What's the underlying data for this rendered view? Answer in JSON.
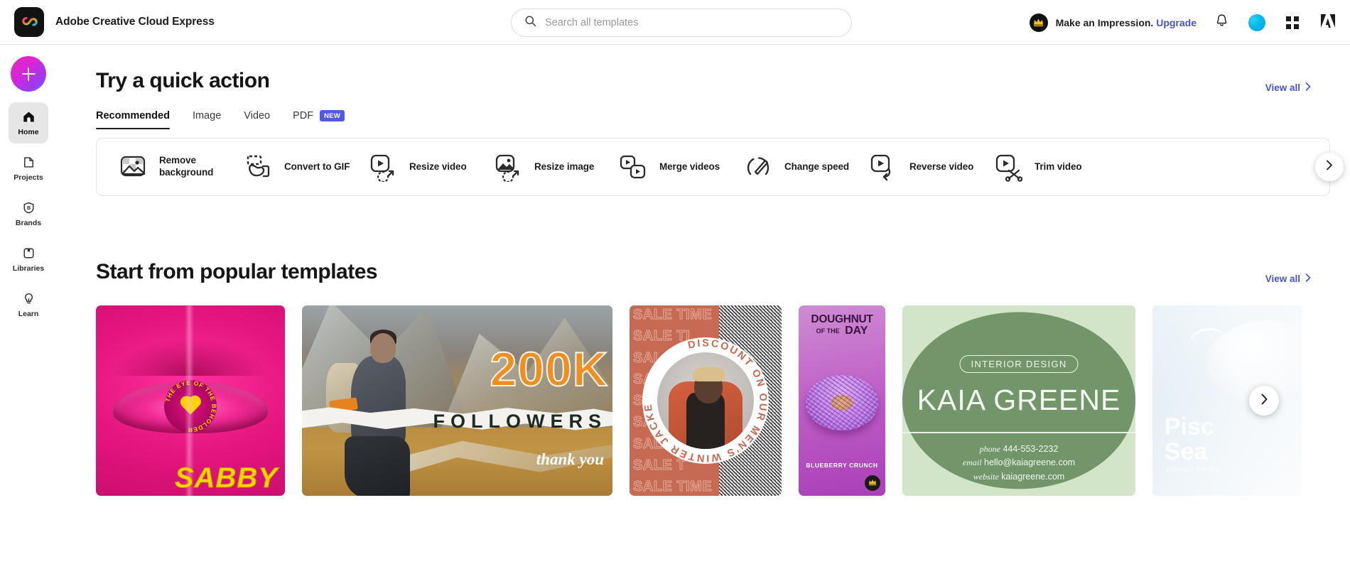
{
  "app": {
    "brand_name": "Adobe Creative Cloud Express",
    "logo_icon": "creative-cloud-express-logo"
  },
  "search": {
    "placeholder": "Search all templates",
    "value": "",
    "icon": "search-icon"
  },
  "header": {
    "upsell_text": "Make an Impression.",
    "upsell_link": "Upgrade",
    "crown_icon": "crown-icon",
    "notifications_icon": "bell-icon",
    "avatar_icon": "user-avatar",
    "apps_icon": "app-grid-icon",
    "adobe_icon": "adobe-logo-icon"
  },
  "sidebar": {
    "create_button_label": "+",
    "create_button_icon": "plus-icon",
    "items": [
      {
        "label": "Home",
        "icon": "home-icon",
        "active": true
      },
      {
        "label": "Projects",
        "icon": "document-icon",
        "active": false
      },
      {
        "label": "Brands",
        "icon": "brand-shield-icon",
        "active": false
      },
      {
        "label": "Libraries",
        "icon": "library-box-icon",
        "active": false
      },
      {
        "label": "Learn",
        "icon": "lightbulb-icon",
        "active": false
      }
    ]
  },
  "quick_action": {
    "title": "Try a quick action",
    "view_all": "View all",
    "view_all_icon": "chevron-right-icon",
    "tabs": [
      {
        "label": "Recommended",
        "active": true,
        "badge": ""
      },
      {
        "label": "Image",
        "active": false,
        "badge": ""
      },
      {
        "label": "Video",
        "active": false,
        "badge": ""
      },
      {
        "label": "PDF",
        "active": false,
        "badge": "NEW"
      }
    ],
    "actions": [
      {
        "label": "Remove background",
        "icon": "remove-background-icon"
      },
      {
        "label": "Convert to GIF",
        "icon": "convert-to-gif-icon"
      },
      {
        "label": "Resize video",
        "icon": "resize-video-icon"
      },
      {
        "label": "Resize image",
        "icon": "resize-image-icon"
      },
      {
        "label": "Merge videos",
        "icon": "merge-videos-icon"
      },
      {
        "label": "Change speed",
        "icon": "change-speed-icon"
      },
      {
        "label": "Reverse video",
        "icon": "reverse-video-icon"
      },
      {
        "label": "Trim video",
        "icon": "trim-video-icon"
      }
    ],
    "next_icon": "chevron-right-icon"
  },
  "templates": {
    "title": "Start from popular templates",
    "view_all": "View all",
    "view_all_icon": "chevron-right-icon",
    "next_icon": "chevron-right-icon",
    "cards": [
      {
        "name": "eye-of-the-beholder-sabby",
        "ring_text": "THE EYE OF THE BEHOLDER",
        "artist": "SABBY",
        "premium": false
      },
      {
        "name": "200k-followers-thank-you",
        "count": "200K",
        "subtitle": "FOLLOWERS",
        "thanks": "thank you",
        "premium": false
      },
      {
        "name": "sale-time-winter-jackets",
        "repeat_text": "SALE TIME",
        "ring_text": "DISCOUNT ON OUR MEN'S WINTER JACKETS",
        "repeat_lines": [
          "SALE TIME",
          "SALE TI",
          "SAL",
          "SA",
          "SA",
          "SAL",
          "SALE",
          "SALE T",
          "SALE TIME"
        ],
        "premium": false
      },
      {
        "name": "doughnut-of-the-day",
        "title_line1": "DOUGHNUT",
        "title_line2": "OF THE",
        "title_line3": "DAY",
        "flavor": "BLUEBERRY CRUNCH",
        "premium": true,
        "premium_icon": "crown-icon"
      },
      {
        "name": "kaia-greene-interior-design",
        "eyebrow": "INTERIOR DESIGN",
        "name_text": "KAIA GREENE",
        "phone_label": "phone",
        "phone": "444-553-2232",
        "email_label": "email",
        "email": "hello@kaiagreene.com",
        "website_label": "website",
        "website": "kaiagreene.com",
        "premium": false
      },
      {
        "name": "pisces-season",
        "title_line1": "Pisc",
        "title_line2": "Sea",
        "caption": "Embrace the flow",
        "premium": false
      }
    ]
  },
  "colors": {
    "accent_link": "#4a52c8",
    "badge_new": "#5258e4",
    "sidebar_active": "#e6e6e6",
    "text_primary": "#161616"
  }
}
